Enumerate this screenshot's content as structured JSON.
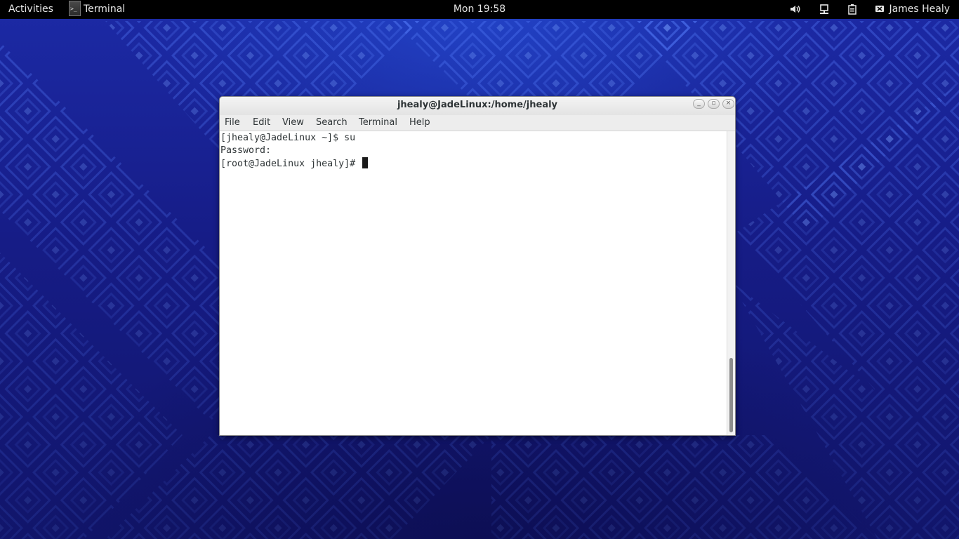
{
  "topbar": {
    "activities": "Activities",
    "app_name": "Terminal",
    "clock": "Mon 19:58",
    "user": "James Healy",
    "icons": [
      "volume-icon",
      "network-icon",
      "battery-icon",
      "user-status-icon"
    ]
  },
  "window": {
    "title": "jhealy@JadeLinux:/home/jhealy",
    "menus": [
      "File",
      "Edit",
      "View",
      "Search",
      "Terminal",
      "Help"
    ],
    "terminal_lines": [
      "[jhealy@JadeLinux ~]$ su",
      "Password:",
      "[root@JadeLinux jhealy]# "
    ],
    "scroll_position": 1.0
  },
  "colors": {
    "topbar_bg": "#000000",
    "desktop_bg": "#1a1f8a",
    "terminal_bg": "#ffffff",
    "terminal_fg": "#2e3436"
  }
}
